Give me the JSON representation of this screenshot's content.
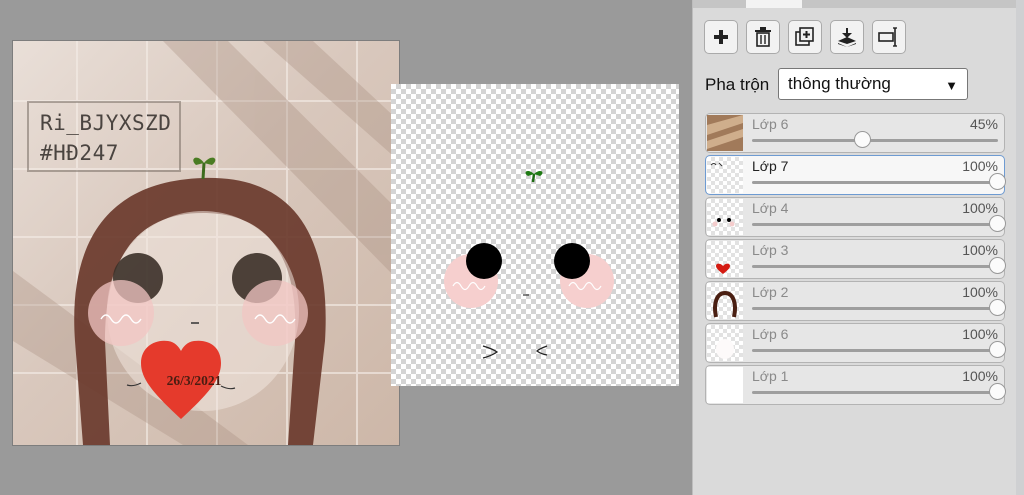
{
  "canvas": {
    "watermark_line1": "Ri_BJYXSZD",
    "watermark_line2": "#HĐ247",
    "heart_text": "26/3/2021"
  },
  "panel": {
    "toolbar": [
      {
        "name": "add-layer-button",
        "icon": "plus-icon"
      },
      {
        "name": "delete-layer-button",
        "icon": "trash-icon"
      },
      {
        "name": "duplicate-layer-button",
        "icon": "duplicate-icon"
      },
      {
        "name": "merge-down-button",
        "icon": "merge-down-icon"
      },
      {
        "name": "layer-properties-button",
        "icon": "layer-properties-icon"
      }
    ],
    "blend_label": "Pha trộn",
    "blend_value": "thông thường",
    "layers": [
      {
        "name": "Lớp 6",
        "opacity_label": "45%",
        "opacity": 0.45,
        "active": false,
        "thumb": "photo"
      },
      {
        "name": "Lớp 7",
        "opacity_label": "100%",
        "opacity": 1.0,
        "active": true,
        "thumb": "sketch"
      },
      {
        "name": "Lớp 4",
        "opacity_label": "100%",
        "opacity": 1.0,
        "active": false,
        "thumb": "eyes"
      },
      {
        "name": "Lớp 3",
        "opacity_label": "100%",
        "opacity": 1.0,
        "active": false,
        "thumb": "heart"
      },
      {
        "name": "Lớp 2",
        "opacity_label": "100%",
        "opacity": 1.0,
        "active": false,
        "thumb": "outline"
      },
      {
        "name": "Lớp 6",
        "opacity_label": "100%",
        "opacity": 1.0,
        "active": false,
        "thumb": "face"
      },
      {
        "name": "Lớp 1",
        "opacity_label": "100%",
        "opacity": 1.0,
        "active": false,
        "thumb": "white"
      }
    ]
  }
}
